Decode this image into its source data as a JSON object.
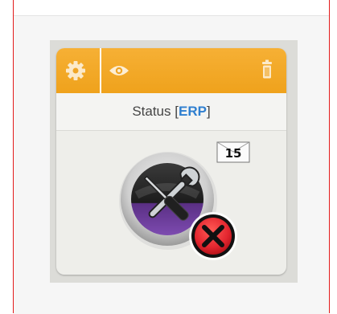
{
  "widget": {
    "title_label": "Status",
    "title_tag": "ERP",
    "message_count": "15"
  },
  "icons": {
    "settings": "gear-icon",
    "view": "eye-icon",
    "delete": "trash-icon",
    "status": "tools-icon",
    "error": "close-icon",
    "messages": "envelope-icon"
  },
  "colors": {
    "toolbar": "#F0A526",
    "tag": "#2F7FD0",
    "error": "#E3262F",
    "frame": "#E21A1A"
  }
}
